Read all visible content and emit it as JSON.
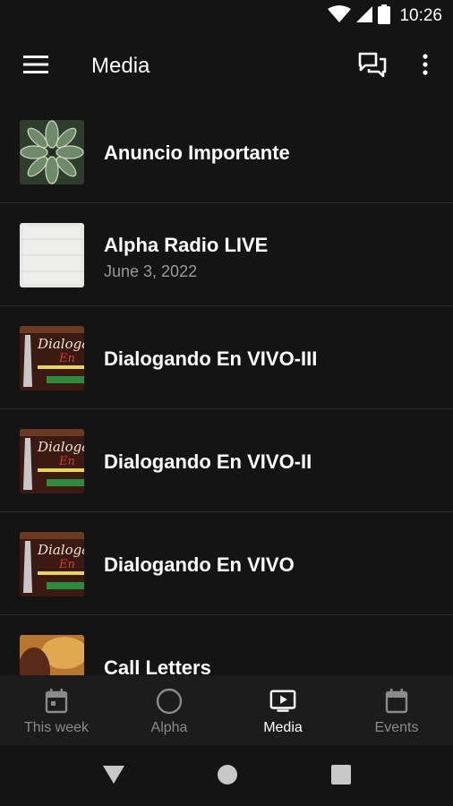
{
  "status_bar": {
    "time": "10:26",
    "icons": [
      "wifi-icon",
      "signal-icon",
      "battery-icon"
    ]
  },
  "app_bar": {
    "title": "Media",
    "icons": [
      "menu-icon",
      "chat-icon",
      "more-vert-icon"
    ]
  },
  "media_list": [
    {
      "title": "Anuncio Importante",
      "subtitle": "",
      "thumb": "leaves"
    },
    {
      "title": "Alpha Radio LIVE",
      "subtitle": "June 3, 2022",
      "thumb": "white-texture"
    },
    {
      "title": "Dialogando En VIVO-III",
      "subtitle": "",
      "thumb": "dialogando-poster"
    },
    {
      "title": "Dialogando En VIVO-II",
      "subtitle": "",
      "thumb": "dialogando-poster"
    },
    {
      "title": "Dialogando En VIVO",
      "subtitle": "",
      "thumb": "dialogando-poster"
    },
    {
      "title": "Call Letters",
      "subtitle": "",
      "thumb": "warm-photo"
    }
  ],
  "bottom_nav": {
    "items": [
      {
        "label": "This week",
        "icon": "calendar-icon"
      },
      {
        "label": "Alpha",
        "icon": "circle-icon"
      },
      {
        "label": "Media",
        "icon": "tv-play-icon"
      },
      {
        "label": "Events",
        "icon": "calendar-icon"
      }
    ],
    "active": "Media"
  },
  "poster_text": {
    "line1": "Dialogan",
    "line2": "En"
  },
  "colors": {
    "background": "#141414",
    "nav_background": "#1c1c1c",
    "text": "#ffffff",
    "muted": "#9a9a9a",
    "nav_inactive": "#8a8a8a"
  }
}
